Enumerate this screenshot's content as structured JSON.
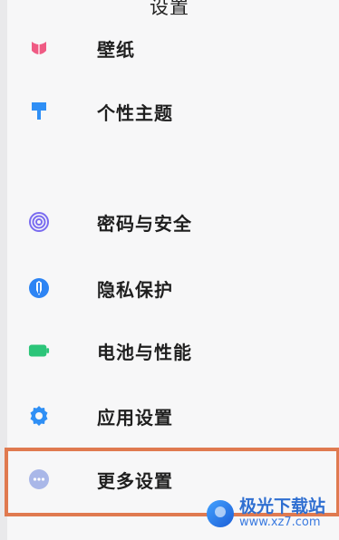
{
  "header": {
    "title": "设置"
  },
  "menu": {
    "items": [
      {
        "label": "壁纸",
        "icon": "wallpaper-icon",
        "color": "#ef5b84"
      },
      {
        "label": "个性主题",
        "icon": "theme-brush-icon",
        "color": "#2f8ff5"
      },
      {
        "label": "密码与安全",
        "icon": "fingerprint-icon",
        "color": "#7a6cf0"
      },
      {
        "label": "隐私保护",
        "icon": "privacy-shield-icon",
        "color": "#2d84f4"
      },
      {
        "label": "电池与性能",
        "icon": "battery-icon",
        "color": "#2cc579"
      },
      {
        "label": "应用设置",
        "icon": "gear-icon",
        "color": "#2f8ff5"
      },
      {
        "label": "更多设置",
        "icon": "more-dots-icon",
        "color": "#a9b7e8"
      }
    ]
  },
  "highlight": {
    "color": "#e07a50",
    "target": "更多设置"
  },
  "watermark": {
    "name": "极光下载站",
    "url": "www.xz7.com"
  }
}
